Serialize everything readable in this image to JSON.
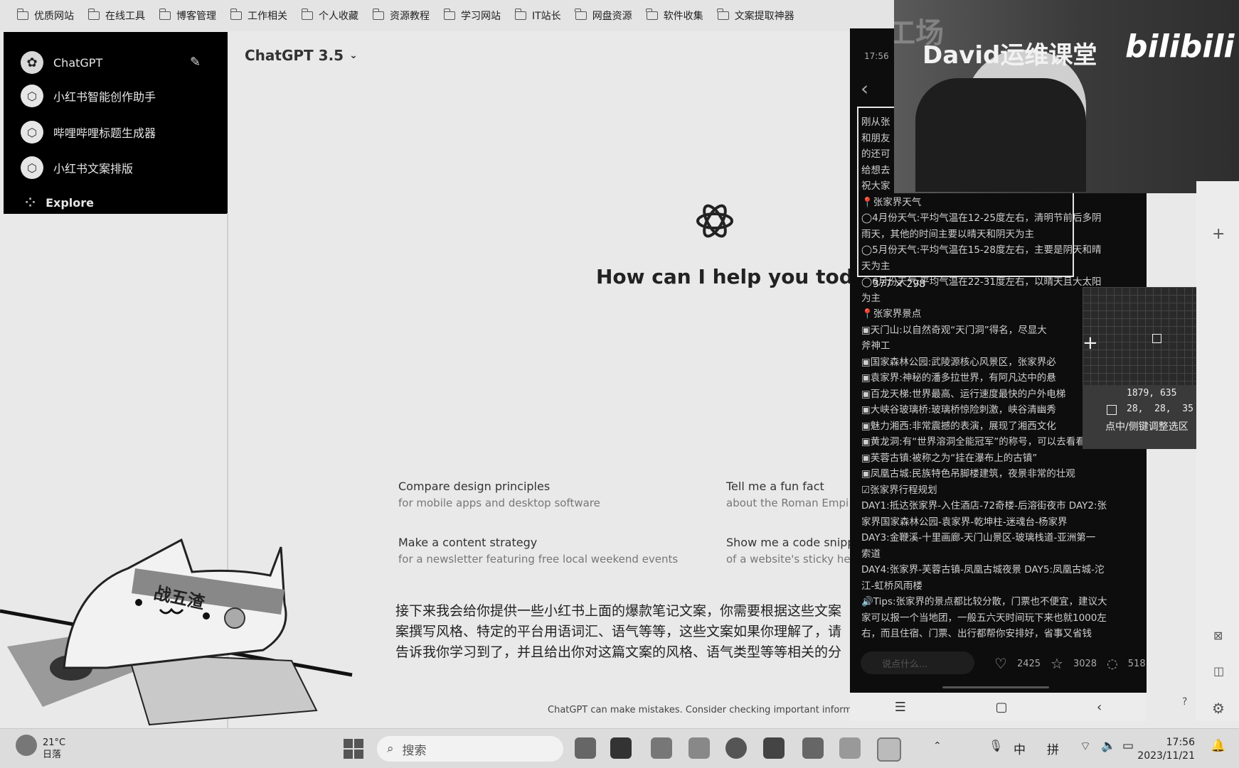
{
  "bookmarks": [
    "优质网站",
    "在线工具",
    "博客管理",
    "工作相关",
    "个人收藏",
    "资源教程",
    "学习网站",
    "IT站长",
    "网盘资源",
    "软件收集",
    "文案提取神器"
  ],
  "sidebar": {
    "brand": "ChatGPT",
    "items": [
      "小红书智能创作助手",
      "哔哩哔哩标题生成器",
      "小红书文案排版"
    ],
    "explore": "Explore"
  },
  "main": {
    "model": "ChatGPT 3.5",
    "greeting": "How can I help you today?",
    "suggestions": [
      {
        "title": "Compare design principles",
        "sub": "for mobile apps and desktop software"
      },
      {
        "title": "Tell me a fun fact",
        "sub": "about the Roman Empi"
      },
      {
        "title": "Make a content strategy",
        "sub": "for a newsletter featuring free local weekend events"
      },
      {
        "title": "Show me a code snippe",
        "sub": "of a website's sticky he"
      }
    ],
    "prompt": "接下来我会给你提供一些小红书上面的爆款笔记文案，你需要根据这些文案案撰写风格、特定的平台用语词汇、语气等等，这些文案如果你理解了，请告诉我你学习到了，并且给出你对这篇文案的风格、语气类型等等相关的分",
    "disclaimer": "ChatGPT can make mistakes. Consider checking important inform"
  },
  "phone": {
    "time": "17:56",
    "note_lines": [
      "刚从张",
      "和朋友",
      "的还可",
      "给想去",
      "祝大家",
      "📍张家界天气",
      "◯4月份天气:平均气温在12-25度左右，清明节前后多阴",
      "雨天，其他的时间主要以晴天和阴天为主",
      "◯5月份天气:平均气温在15-28度左右，主要是阴天和晴",
      "天为主",
      "◯6月份天气:平均气温在22-31度左右，以晴天且大太阳",
      "为主",
      "📍张家界景点",
      "▣天门山:以自然奇观“天门洞”得名，尽显大",
      "斧神工",
      "▣国家森林公园:武陵源核心风景区，张家界必",
      "▣袁家界:神秘的潘多拉世界，有阿凡达中的悬",
      "▣百龙天梯:世界最高、运行速度最快的户外电梯",
      "▣大峡谷玻璃桥:玻璃桥惊险刺激，峡谷清幽秀",
      "▣魅力湘西:非常震撼的表演，展现了湘西文化",
      "▣黄龙洞:有“世界溶洞全能冠军”的称号，可以去看看",
      "▣芙蓉古镇:被称之为“挂在瀑布上的古镇”",
      "▣凤凰古城:民族特色吊脚楼建筑，夜景非常的壮观",
      "☑张家界行程规划",
      "DAY1:抵达张家界-入住酒店-72奇楼-后溶街夜市 DAY2:张",
      "家界国家森林公园-袁家界-乾坤柱-迷魂台-杨家界",
      "DAY3:金鞭溪-十里画廊-天门山景区-玻璃栈道-亚洲第一",
      "索道",
      "DAY4:张家界-芙蓉古镇-凤凰古城夜景 DAY5:凤凰古城-沱",
      "江-虹桥风雨楼",
      "🔊Tips:张家界的景点都比较分散，门票也不便宜，建议大",
      "家可以报一个当地团，一般五六天时间玩下来也就1000左",
      "右，而且住宿、门票、出行都帮你安排好，省事又省钱"
    ],
    "size_readout": "377 × 298",
    "comment_placeholder": "说点什么...",
    "likes": "2425",
    "stars": "3028",
    "comments": "518"
  },
  "webcam": {
    "overlay": "David运维课堂",
    "logo": "bilibili",
    "watermark": "大咖课工场"
  },
  "magnifier": {
    "coords": "1879, 635",
    "rgb": "28,  28,  35",
    "hint": "点中/侧键调整选区"
  },
  "taskbar": {
    "weather_temp": "21°C",
    "weather_desc": "日落",
    "search": "搜索",
    "ime_lang": "中",
    "ime_mode": "拼",
    "time": "17:56",
    "date": "2023/11/21"
  },
  "cat_banner": "战五渣"
}
